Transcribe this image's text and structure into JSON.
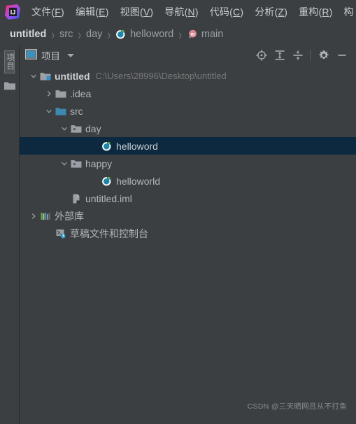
{
  "app": {
    "logo_name": "intellij-idea-logo",
    "accent_blue": "#3592c4",
    "selection_bg": "#0d293f",
    "panel_bg": "#3c3f41"
  },
  "menubar": {
    "items": [
      {
        "label": "文件(F)",
        "text": "文件(",
        "mnemonic": "F",
        "close": ")"
      },
      {
        "label": "编辑(E)",
        "text": "编辑(",
        "mnemonic": "E",
        "close": ")"
      },
      {
        "label": "视图(V)",
        "text": "视图(",
        "mnemonic": "V",
        "close": ")"
      },
      {
        "label": "导航(N)",
        "text": "导航(",
        "mnemonic": "N",
        "close": ")"
      },
      {
        "label": "代码(C)",
        "text": "代码(",
        "mnemonic": "C",
        "close": ")"
      },
      {
        "label": "分析(Z)",
        "text": "分析(",
        "mnemonic": "Z",
        "close": ")"
      },
      {
        "label": "重构(R)",
        "text": "重构(",
        "mnemonic": "R",
        "close": ")"
      },
      {
        "label": "构",
        "text": "构",
        "mnemonic": "",
        "close": ""
      }
    ]
  },
  "breadcrumb": {
    "separator": "›",
    "items": [
      {
        "label": "untitled",
        "icon": "",
        "bold": true
      },
      {
        "label": "src",
        "icon": "",
        "bold": false
      },
      {
        "label": "day",
        "icon": "",
        "bold": false
      },
      {
        "label": "helloword",
        "icon": "kotlin-class-icon",
        "bold": false
      },
      {
        "label": "main",
        "icon": "method-icon",
        "bold": false
      }
    ]
  },
  "stripe": {
    "tab_label": "项目",
    "folder_icon": "folder-icon"
  },
  "panel": {
    "title": "项目",
    "title_icon": "project-window-icon",
    "dropdown_icon": "chevron-down-icon",
    "buttons": [
      {
        "name": "select-opened-file-icon",
        "tooltip": ""
      },
      {
        "name": "expand-all-icon",
        "tooltip": ""
      },
      {
        "name": "collapse-all-icon",
        "tooltip": ""
      },
      {
        "name": "settings-gear-icon",
        "tooltip": ""
      },
      {
        "name": "hide-minimize-icon",
        "tooltip": ""
      }
    ]
  },
  "tree": {
    "rows": [
      {
        "name": "tree-row-untitled",
        "label": "untitled",
        "sub": "C:\\Users\\28996\\Desktop\\untitled",
        "icon": "module-folder-icon",
        "twisty": "expanded",
        "indent": 0,
        "bold": true,
        "selected": false
      },
      {
        "name": "tree-row-idea",
        "label": ".idea",
        "sub": "",
        "icon": "folder-icon",
        "twisty": "collapsed",
        "indent": 1,
        "bold": false,
        "selected": false
      },
      {
        "name": "tree-row-src",
        "label": "src",
        "sub": "",
        "icon": "source-folder-icon",
        "twisty": "expanded",
        "indent": 1,
        "bold": false,
        "selected": false
      },
      {
        "name": "tree-row-day",
        "label": "day",
        "sub": "",
        "icon": "package-folder-icon",
        "twisty": "expanded",
        "indent": 2,
        "bold": false,
        "selected": false
      },
      {
        "name": "tree-row-helloword",
        "label": "helloword",
        "sub": "",
        "icon": "kotlin-class-icon",
        "twisty": "none",
        "indent": 3,
        "bold": false,
        "selected": true
      },
      {
        "name": "tree-row-happy",
        "label": "happy",
        "sub": "",
        "icon": "package-folder-icon",
        "twisty": "expanded",
        "indent": 2,
        "bold": false,
        "selected": false
      },
      {
        "name": "tree-row-helloworld",
        "label": "helloworld",
        "sub": "",
        "icon": "kotlin-class-icon",
        "twisty": "none",
        "indent": 3,
        "bold": false,
        "selected": false
      },
      {
        "name": "tree-row-untitled-iml",
        "label": "untitled.iml",
        "sub": "",
        "icon": "iml-file-icon",
        "twisty": "none",
        "indent": 2,
        "bold": false,
        "selected": false
      },
      {
        "name": "tree-row-external-libraries",
        "label": "外部库",
        "sub": "",
        "icon": "external-libraries-icon",
        "twisty": "collapsed",
        "indent": 0,
        "bold": false,
        "selected": false
      },
      {
        "name": "tree-row-scratches",
        "label": "草稿文件和控制台",
        "sub": "",
        "icon": "scratches-console-icon",
        "twisty": "none",
        "indent": 1,
        "bold": false,
        "selected": false
      }
    ]
  },
  "watermark": {
    "text": "CSDN @三天晒网且从不打鱼"
  }
}
